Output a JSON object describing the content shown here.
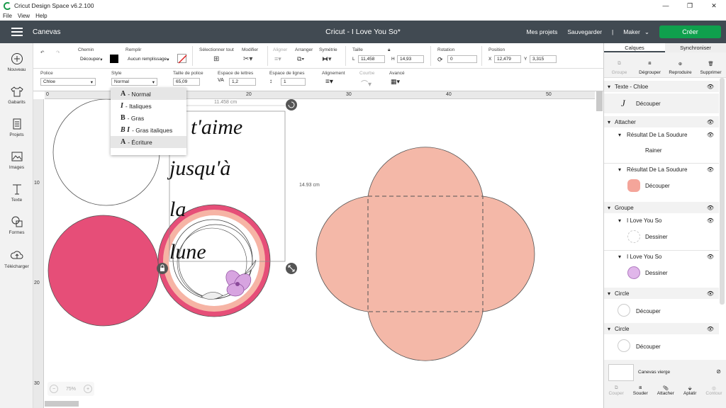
{
  "app": {
    "title": "Cricut Design Space  v6.2.100",
    "menu": [
      "File",
      "View",
      "Help"
    ]
  },
  "header": {
    "section": "Canevas",
    "project_title": "Cricut - I Love You So*",
    "my_projects": "Mes projets",
    "save": "Sauvegarder",
    "machine": "Maker",
    "create": "Créer"
  },
  "leftnav": [
    {
      "label": "Nouveau",
      "icon": "plus-circle-icon"
    },
    {
      "label": "Gabarits",
      "icon": "shirt-icon"
    },
    {
      "label": "Projets",
      "icon": "projects-icon"
    },
    {
      "label": "Images",
      "icon": "image-icon"
    },
    {
      "label": "Texte",
      "icon": "text-icon"
    },
    {
      "label": "Formes",
      "icon": "shapes-icon"
    },
    {
      "label": "Télécharger",
      "icon": "upload-cloud-icon"
    }
  ],
  "toolbar": {
    "operation_label": "Chemin",
    "operation_value": "Découper",
    "fill_label": "Remplir",
    "fill_value": "Aucun remplissage",
    "select_all": "Sélectionner tout",
    "edit": "Modifier",
    "align": "Aligner",
    "arrange": "Arranger",
    "flip": "Symétrie",
    "size_label": "Taille",
    "width_prefix": "L",
    "width": "11,458",
    "height_prefix": "H",
    "height": "14,93",
    "rotation_label": "Rotation",
    "rotation": "0",
    "position_label": "Position",
    "x_prefix": "X",
    "x": "12,479",
    "y_prefix": "Y",
    "y": "3,315"
  },
  "toolbar2": {
    "font_label": "Police",
    "font": "Chloe",
    "style_label": "Style",
    "style": "Normal",
    "font_size_label": "Taille de police",
    "font_size": "65,09",
    "letter_spacing_label": "Espace de lettres",
    "letter_spacing": "1,2",
    "line_spacing_label": "Espace de lignes",
    "line_spacing": "1",
    "alignment_label": "Alignement",
    "curve_label": "Courbe",
    "advanced_label": "Avancé"
  },
  "style_menu": [
    {
      "glyph": "A",
      "label": "- Normal"
    },
    {
      "glyph": "I",
      "label": "- Italiques"
    },
    {
      "glyph": "B",
      "label": "- Gras"
    },
    {
      "glyph": "B I",
      "label": "- Gras italiques"
    },
    {
      "glyph": "A",
      "label": "- Écriture"
    }
  ],
  "canvas": {
    "ruler_h": [
      "0",
      "10",
      "20",
      "30",
      "40",
      "50"
    ],
    "ruler_v": [
      "10",
      "20",
      "30"
    ],
    "width_dim": "11.458 cm",
    "height_dim": "14.93 cm",
    "text_lines": [
      "Je t'aime",
      "jusqu'à",
      "la",
      "lune"
    ],
    "zoom": "75%",
    "colors": {
      "pink": "#e64e78",
      "salmon": "#f6b4a5",
      "peach": "#f4b8a8"
    }
  },
  "panel": {
    "tabs": [
      "Calques",
      "Synchroniser"
    ],
    "actions": [
      "Groupe",
      "Dégrouper",
      "Reproduire",
      "Supprimer"
    ],
    "layers": [
      {
        "group": "Texte - Chloe",
        "items": [
          {
            "op": "Découper"
          }
        ]
      },
      {
        "group": "Attacher",
        "items": [
          {
            "sub": "Résultat De La Soudure",
            "op": "Rainer"
          },
          {
            "sub": "Résultat De La Soudure",
            "op": "Découper"
          }
        ]
      },
      {
        "group": "Groupe",
        "items": [
          {
            "sub": "I Love You So",
            "op": "Dessiner"
          },
          {
            "sub": "I Love You So",
            "op": "Dessiner"
          }
        ]
      },
      {
        "group": "Circle",
        "items": [
          {
            "op": "Découper"
          }
        ]
      },
      {
        "group": "Circle",
        "items": [
          {
            "op": "Découper"
          }
        ]
      }
    ],
    "blank_canvas": "Canevas vierge",
    "bottom": [
      "Couper",
      "Souder",
      "Attacher",
      "Aplatir",
      "Contour"
    ]
  }
}
